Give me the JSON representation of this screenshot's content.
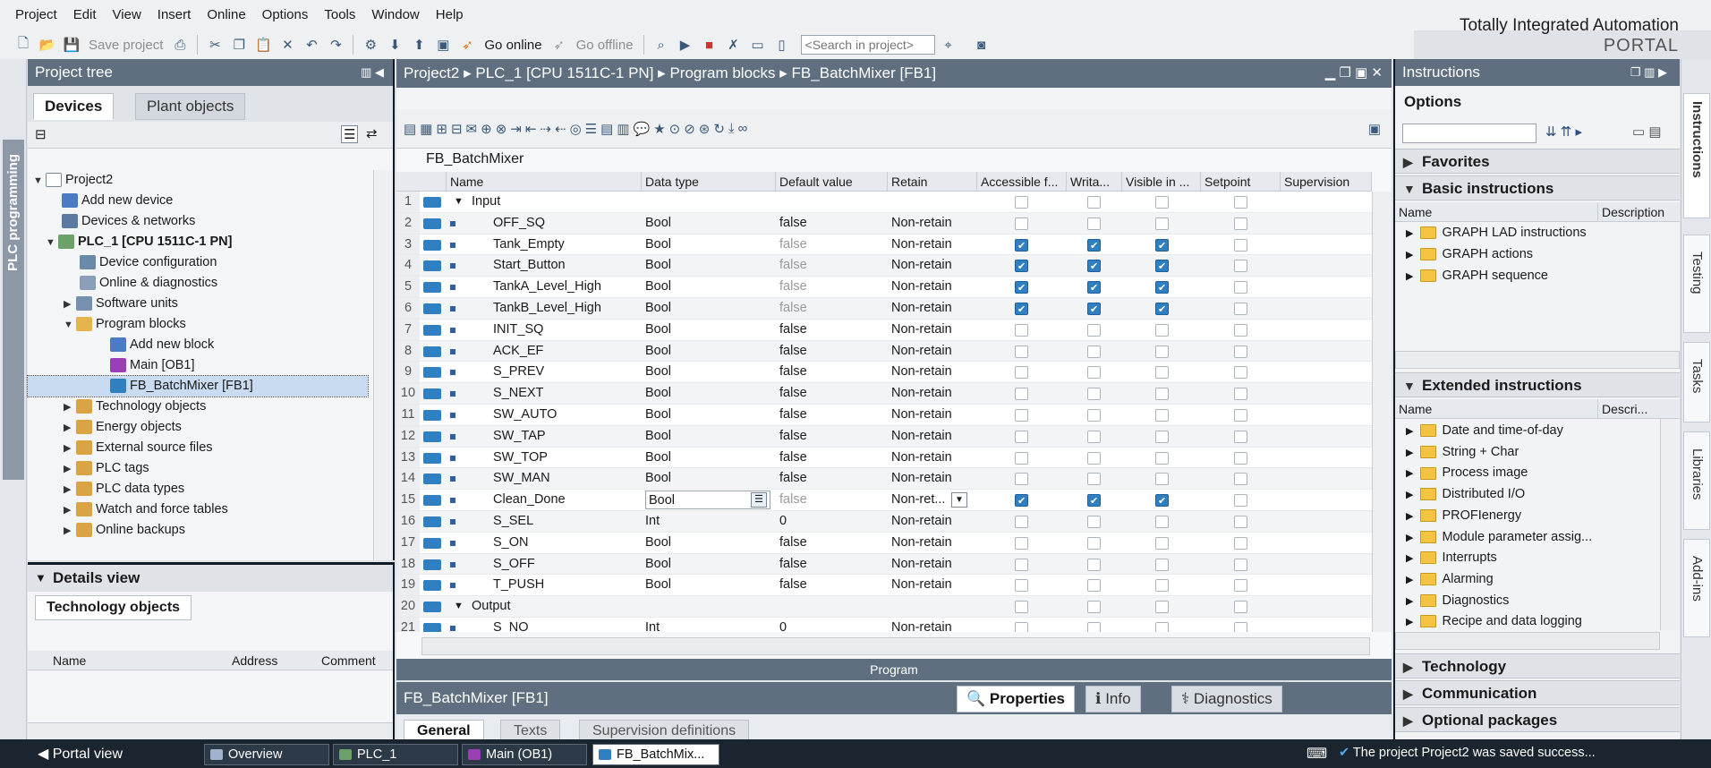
{
  "menu": [
    "Project",
    "Edit",
    "View",
    "Insert",
    "Online",
    "Options",
    "Tools",
    "Window",
    "Help"
  ],
  "brand": {
    "line1": "Totally Integrated Automation",
    "line2": "PORTAL"
  },
  "toolbar": {
    "save_label": "Save project",
    "go_online": "Go online",
    "go_offline": "Go offline",
    "search_placeholder": "<Search in project>"
  },
  "left_strip": {
    "label": "PLC programming"
  },
  "project_tree": {
    "title": "Project tree",
    "tabs": [
      "Devices",
      "Plant objects"
    ],
    "items": [
      {
        "label": "Project2"
      },
      {
        "label": "Add new device"
      },
      {
        "label": "Devices & networks"
      },
      {
        "label": "PLC_1 [CPU 1511C-1 PN]"
      },
      {
        "label": "Device configuration"
      },
      {
        "label": "Online & diagnostics"
      },
      {
        "label": "Software units"
      },
      {
        "label": "Program blocks"
      },
      {
        "label": "Add new block"
      },
      {
        "label": "Main [OB1]"
      },
      {
        "label": "FB_BatchMixer [FB1]"
      },
      {
        "label": "Technology objects"
      },
      {
        "label": "Energy objects"
      },
      {
        "label": "External source files"
      },
      {
        "label": "PLC tags"
      },
      {
        "label": "PLC data types"
      },
      {
        "label": "Watch and force tables"
      },
      {
        "label": "Online backups"
      }
    ]
  },
  "details": {
    "title": "Details view",
    "tab": "Technology objects",
    "columns": [
      "Name",
      "Address",
      "Comment"
    ]
  },
  "editor": {
    "breadcrumb": [
      "Project2",
      "PLC_1 [CPU 1511C-1 PN]",
      "Program blocks",
      "FB_BatchMixer [FB1]"
    ],
    "block_name": "FB_BatchMixer",
    "columns": [
      "Name",
      "Data type",
      "Default value",
      "Retain",
      "Accessible f...",
      "Writa...",
      "Visible in ...",
      "Setpoint",
      "Supervision"
    ],
    "rows": [
      {
        "n": "1",
        "name": "Input",
        "type": "",
        "def": "",
        "ret": "",
        "a": false,
        "w": false,
        "v": false
      },
      {
        "n": "2",
        "name": "OFF_SQ",
        "type": "Bool",
        "def": "false",
        "ret": "Non-retain",
        "a": false,
        "w": false,
        "v": false
      },
      {
        "n": "3",
        "name": "Tank_Empty",
        "type": "Bool",
        "def": "false",
        "ret": "Non-retain",
        "a": true,
        "w": true,
        "v": true
      },
      {
        "n": "4",
        "name": "Start_Button",
        "type": "Bool",
        "def": "false",
        "ret": "Non-retain",
        "a": true,
        "w": true,
        "v": true
      },
      {
        "n": "5",
        "name": "TankA_Level_High",
        "type": "Bool",
        "def": "false",
        "ret": "Non-retain",
        "a": true,
        "w": true,
        "v": true
      },
      {
        "n": "6",
        "name": "TankB_Level_High",
        "type": "Bool",
        "def": "false",
        "ret": "Non-retain",
        "a": true,
        "w": true,
        "v": true
      },
      {
        "n": "7",
        "name": "INIT_SQ",
        "type": "Bool",
        "def": "false",
        "ret": "Non-retain",
        "a": false,
        "w": false,
        "v": false
      },
      {
        "n": "8",
        "name": "ACK_EF",
        "type": "Bool",
        "def": "false",
        "ret": "Non-retain",
        "a": false,
        "w": false,
        "v": false
      },
      {
        "n": "9",
        "name": "S_PREV",
        "type": "Bool",
        "def": "false",
        "ret": "Non-retain",
        "a": false,
        "w": false,
        "v": false
      },
      {
        "n": "10",
        "name": "S_NEXT",
        "type": "Bool",
        "def": "false",
        "ret": "Non-retain",
        "a": false,
        "w": false,
        "v": false
      },
      {
        "n": "11",
        "name": "SW_AUTO",
        "type": "Bool",
        "def": "false",
        "ret": "Non-retain",
        "a": false,
        "w": false,
        "v": false
      },
      {
        "n": "12",
        "name": "SW_TAP",
        "type": "Bool",
        "def": "false",
        "ret": "Non-retain",
        "a": false,
        "w": false,
        "v": false
      },
      {
        "n": "13",
        "name": "SW_TOP",
        "type": "Bool",
        "def": "false",
        "ret": "Non-retain",
        "a": false,
        "w": false,
        "v": false
      },
      {
        "n": "14",
        "name": "SW_MAN",
        "type": "Bool",
        "def": "false",
        "ret": "Non-retain",
        "a": false,
        "w": false,
        "v": false
      },
      {
        "n": "15",
        "name": "Clean_Done",
        "type": "Bool",
        "def": "false",
        "ret": "Non-ret...",
        "a": true,
        "w": true,
        "v": true
      },
      {
        "n": "16",
        "name": "S_SEL",
        "type": "Int",
        "def": "0",
        "ret": "Non-retain",
        "a": false,
        "w": false,
        "v": false
      },
      {
        "n": "17",
        "name": "S_ON",
        "type": "Bool",
        "def": "false",
        "ret": "Non-retain",
        "a": false,
        "w": false,
        "v": false
      },
      {
        "n": "18",
        "name": "S_OFF",
        "type": "Bool",
        "def": "false",
        "ret": "Non-retain",
        "a": false,
        "w": false,
        "v": false
      },
      {
        "n": "19",
        "name": "T_PUSH",
        "type": "Bool",
        "def": "false",
        "ret": "Non-retain",
        "a": false,
        "w": false,
        "v": false
      },
      {
        "n": "20",
        "name": "Output",
        "type": "",
        "def": "",
        "ret": "",
        "a": false,
        "w": false,
        "v": false
      },
      {
        "n": "21",
        "name": "S_NO",
        "type": "Int",
        "def": "0",
        "ret": "Non-retain",
        "a": false,
        "w": false,
        "v": false
      }
    ],
    "program_label": "Program"
  },
  "props": {
    "title": "FB_BatchMixer [FB1]",
    "tabs": [
      "Properties",
      "Info",
      "Diagnostics"
    ],
    "subtabs": [
      "General",
      "Texts",
      "Supervision definitions"
    ]
  },
  "instructions": {
    "title": "Instructions",
    "options": "Options",
    "sections": {
      "favorites": "Favorites",
      "basic": "Basic instructions",
      "extended": "Extended instructions",
      "technology": "Technology",
      "communication": "Communication",
      "optional": "Optional packages"
    },
    "col_name": "Name",
    "col_desc": "Description",
    "col_desc_short": "Descri...",
    "basic_items": [
      "GRAPH LAD instructions",
      "GRAPH actions",
      "GRAPH sequence"
    ],
    "extended_items": [
      "Date and time-of-day",
      "String + Char",
      "Process image",
      "Distributed I/O",
      "PROFIenergy",
      "Module parameter assig...",
      "Interrupts",
      "Alarming",
      "Diagnostics",
      "Recipe and data logging"
    ]
  },
  "right_tabs": [
    "Instructions",
    "Testing",
    "Tasks",
    "Libraries",
    "Add-ins"
  ],
  "statusbar": {
    "portal": "Portal view",
    "tabs": [
      "Overview",
      "PLC_1",
      "Main (OB1)",
      "FB_BatchMix..."
    ],
    "message": "The project Project2 was saved success..."
  }
}
